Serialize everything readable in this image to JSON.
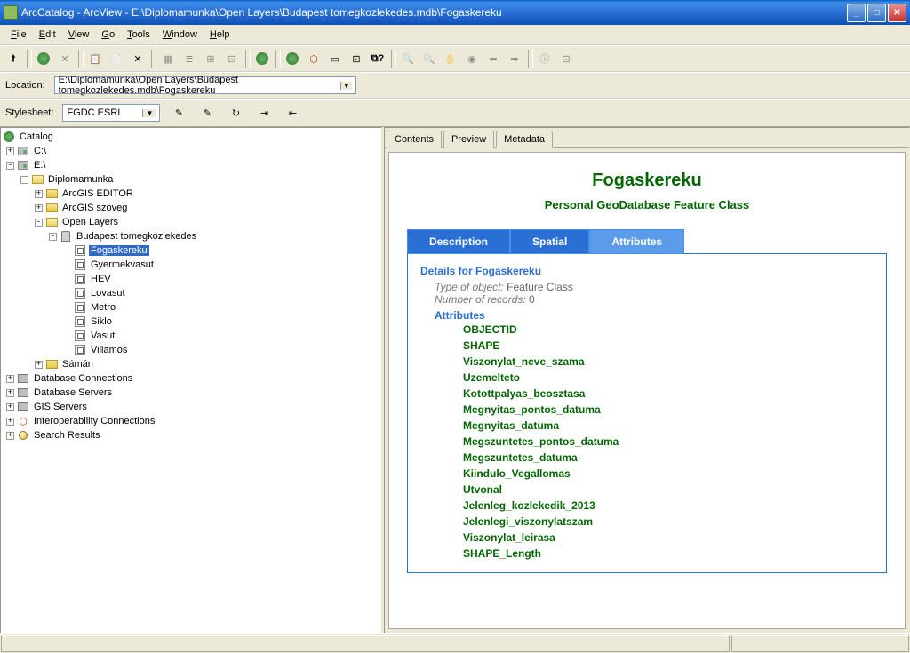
{
  "window": {
    "title": "ArcCatalog - ArcView - E:\\Diplomamunka\\Open Layers\\Budapest tomegkozlekedes.mdb\\Fogaskereku"
  },
  "menu": {
    "file": "File",
    "edit": "Edit",
    "view": "View",
    "go": "Go",
    "tools": "Tools",
    "window": "Window",
    "help": "Help"
  },
  "location": {
    "label": "Location:",
    "value": "E:\\Diplomamunka\\Open Layers\\Budapest tomegkozlekedes.mdb\\Fogaskereku"
  },
  "stylesheet": {
    "label": "Stylesheet:",
    "value": "FGDC ESRI"
  },
  "tree": {
    "root": "Catalog",
    "c_drive": "C:\\",
    "e_drive": "E:\\",
    "diplomamunka": "Diplomamunka",
    "arcgis_editor": "ArcGIS EDITOR",
    "arcgis_szoveg": "ArcGIS szoveg",
    "open_layers": "Open Layers",
    "budapest_db": "Budapest tomegkozlekedes",
    "fc_fogaskereku": "Fogaskereku",
    "fc_gyermekvasut": "Gyermekvasut",
    "fc_hev": "HEV",
    "fc_lovasut": "Lovasut",
    "fc_metro": "Metro",
    "fc_siklo": "Siklo",
    "fc_vasut": "Vasut",
    "fc_villamos": "Villamos",
    "saman": "Sámán",
    "db_connections": "Database Connections",
    "db_servers": "Database Servers",
    "gis_servers": "GIS Servers",
    "interop": "Interoperability Connections",
    "search_results": "Search Results"
  },
  "tabs": {
    "contents": "Contents",
    "preview": "Preview",
    "metadata": "Metadata"
  },
  "metadata": {
    "title": "Fogaskereku",
    "subtitle": "Personal GeoDatabase Feature Class",
    "tab_description": "Description",
    "tab_spatial": "Spatial",
    "tab_attributes": "Attributes",
    "details_for": "Details for Fogaskereku",
    "type_label": "Type of object:",
    "type_value": " Feature Class",
    "records_label": "Number of records:",
    "records_value": " 0",
    "attributes_header": "Attributes",
    "attributes": [
      "OBJECTID",
      "SHAPE",
      "Viszonylat_neve_szama",
      "Uzemelteto",
      "Kotottpalyas_beosztasa",
      "Megnyitas_pontos_datuma",
      "Megnyitas_datuma",
      "Megszuntetes_pontos_datuma",
      "Megszuntetes_datuma",
      "Kiindulo_Vegallomas",
      "Utvonal",
      "Jelenleg_kozlekedik_2013",
      "Jelenlegi_viszonylatszam",
      "Viszonylat_leirasa",
      "SHAPE_Length"
    ]
  }
}
